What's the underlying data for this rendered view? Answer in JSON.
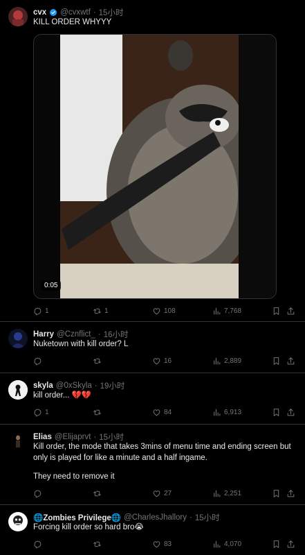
{
  "posts": [
    {
      "name": "cvx",
      "handle": "@cvxwtf",
      "sep": "·",
      "time": "15小时",
      "verified": true,
      "text": "KILL ORDER WHYYY",
      "video_duration": "0:05",
      "replies": "1",
      "reposts": "1",
      "likes": "108",
      "views": "7,768"
    },
    {
      "name": "Harry",
      "handle": "@Cznflict_",
      "sep": "·",
      "time": "16小时",
      "text": "Nuketown with kill order? L",
      "replies": "",
      "reposts": "",
      "likes": "16",
      "views": "2,889"
    },
    {
      "name": "skyla",
      "handle": "@0xSkyla",
      "sep": "·",
      "time": "19小时",
      "text": "kill order... 💔💔",
      "replies": "1",
      "reposts": "",
      "likes": "84",
      "views": "6,913"
    },
    {
      "name": "Elias",
      "handle": "@Elijaprvt",
      "sep": "·",
      "time": "15小时",
      "text": "Kill order, the mode that takes 3mins of menu time and ending screen but only is played for like a minute and a half ingame.",
      "text2": "They need to remove it",
      "replies": "",
      "reposts": "",
      "likes": "27",
      "views": "2,251"
    },
    {
      "name": "🌐Zombies Privilege🌐",
      "handle": "@CharlesJhallory",
      "sep": "·",
      "time": "15小时",
      "text": "Forcing kill order so hard bro😭",
      "replies": "",
      "reposts": "",
      "likes": "83",
      "views": "4,070"
    }
  ],
  "colors": {
    "background": "#000000",
    "text": "#e7e9ea",
    "muted": "#71767b",
    "verified": "#1d9bf0",
    "divider": "#2f3336"
  },
  "icons": [
    "reply-icon",
    "repost-icon",
    "like-icon",
    "views-icon",
    "bookmark-icon",
    "share-icon",
    "verified-icon"
  ]
}
